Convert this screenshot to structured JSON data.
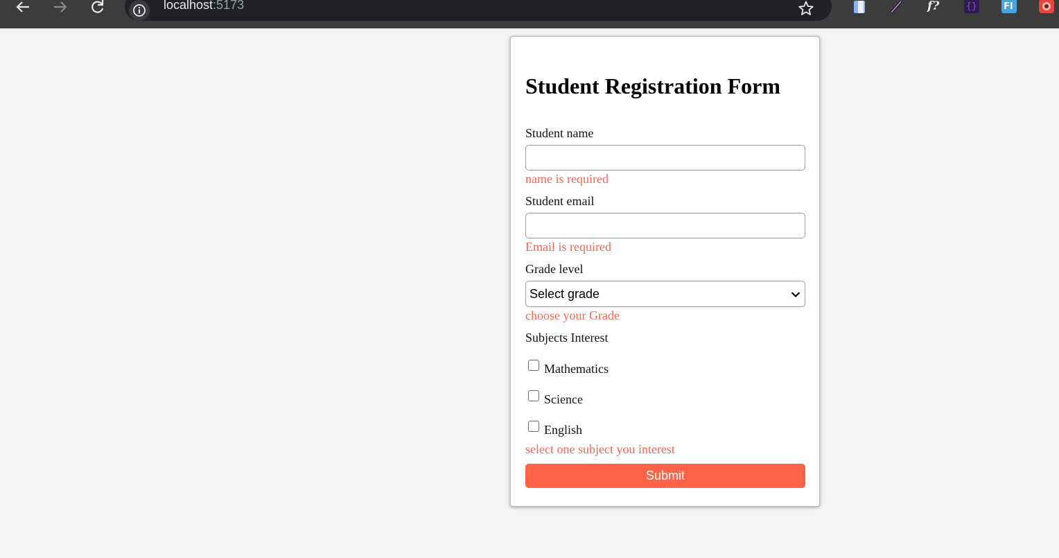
{
  "browser": {
    "url_host": "localhost",
    "url_port": ":5173",
    "extensions": [
      {
        "name": "sheet-extension-icon",
        "color": "#8ab4f8"
      },
      {
        "name": "pen-extension-icon",
        "color": "#c58af9"
      },
      {
        "name": "fontface-extension-icon",
        "color": "#e8eaed",
        "glyph": "f?"
      },
      {
        "name": "json-extension-icon",
        "color": "#a142f4",
        "glyph": "{ }"
      },
      {
        "name": "fi-extension-icon",
        "color": "#4aa3df",
        "glyph": "FI"
      },
      {
        "name": "bug-extension-icon",
        "color": "#e8453c"
      }
    ]
  },
  "form": {
    "title": "Student Registration Form",
    "name_label": "Student name",
    "name_value": "",
    "name_error": "name is required",
    "email_label": "Student email",
    "email_value": "",
    "email_error": "Email is required",
    "grade_label": "Grade level",
    "grade_selected": "Select grade",
    "grade_error": "choose your Grade",
    "subjects_label": "Subjects Interest",
    "subjects": [
      {
        "label": "Mathematics",
        "checked": false
      },
      {
        "label": "Science",
        "checked": false
      },
      {
        "label": "English",
        "checked": false
      }
    ],
    "subjects_error": "select one subject you interest",
    "submit_label": "Submit"
  },
  "colors": {
    "page_background": "#f4f4f3",
    "error": "#f26552",
    "submit": "#ff6347",
    "chrome": "#3c3c3c"
  }
}
